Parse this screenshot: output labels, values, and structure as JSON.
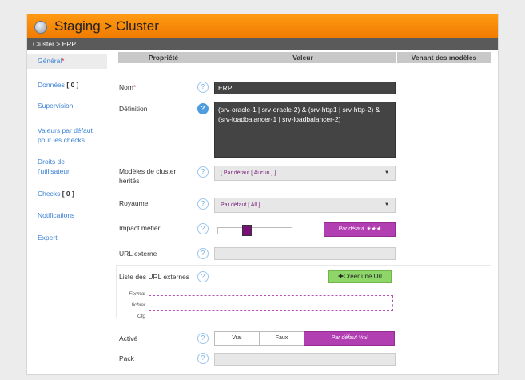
{
  "window": {
    "title": "Staging > Cluster",
    "breadcrumb": "Cluster > ERP"
  },
  "sidebar": {
    "items": [
      {
        "label": "Général",
        "required": "*",
        "count": ""
      },
      {
        "label": "Données",
        "required": "",
        "count": "[ 0 ]"
      },
      {
        "label": "Supervision",
        "required": "",
        "count": ""
      },
      {
        "label": "Valeurs par défaut",
        "label2": "pour les checks",
        "required": "",
        "count": ""
      },
      {
        "label": "Droits de",
        "label2": "l'utilisateur",
        "required": "",
        "count": ""
      },
      {
        "label": "Checks",
        "required": "",
        "count": "[ 0 ]"
      },
      {
        "label": "Notifications",
        "required": "",
        "count": ""
      },
      {
        "label": "Expert",
        "required": "",
        "count": ""
      }
    ]
  },
  "table": {
    "headers": [
      "Propriété",
      "Valeur",
      "Venant des modèles"
    ]
  },
  "form": {
    "nom": {
      "label": "Nom",
      "required": "*",
      "value": "ERP"
    },
    "definition": {
      "label": "Définition",
      "value": "(srv-oracle-1 | srv-oracle-2) & (srv-http1 | srv-http-2) & (srv-loadbalancer-1 | srv-loadbalancer-2)"
    },
    "modeles": {
      "label": "Modèles de cluster",
      "label2": "hérités",
      "value": "[ Par défaut [ Aucun ] ]"
    },
    "royaume": {
      "label": "Royaume",
      "value": "Par défaut [ All ]"
    },
    "impact": {
      "label": "Impact métier",
      "level": 0.33,
      "default_label": "Par défaut ★★★"
    },
    "url_externe": {
      "label": "URL externe",
      "value": ""
    },
    "url_list": {
      "label": "Liste des URL externes",
      "create_button": "Créer une Url",
      "plus": "✚",
      "format_lines": [
        "Format",
        "fichier",
        "Cfg"
      ]
    },
    "active": {
      "label": "Activé",
      "options": [
        "Vrai",
        "Faux"
      ],
      "default_label": "Par défaut",
      "default_value": "Vrai"
    },
    "pack": {
      "label": "Pack",
      "value": ""
    }
  },
  "help_glyph": "?",
  "colors": {
    "title_bar": "#f58a0b",
    "accent_purple": "#b23fb2",
    "link_blue": "#3b82d4",
    "green_button": "#8fd66a"
  }
}
